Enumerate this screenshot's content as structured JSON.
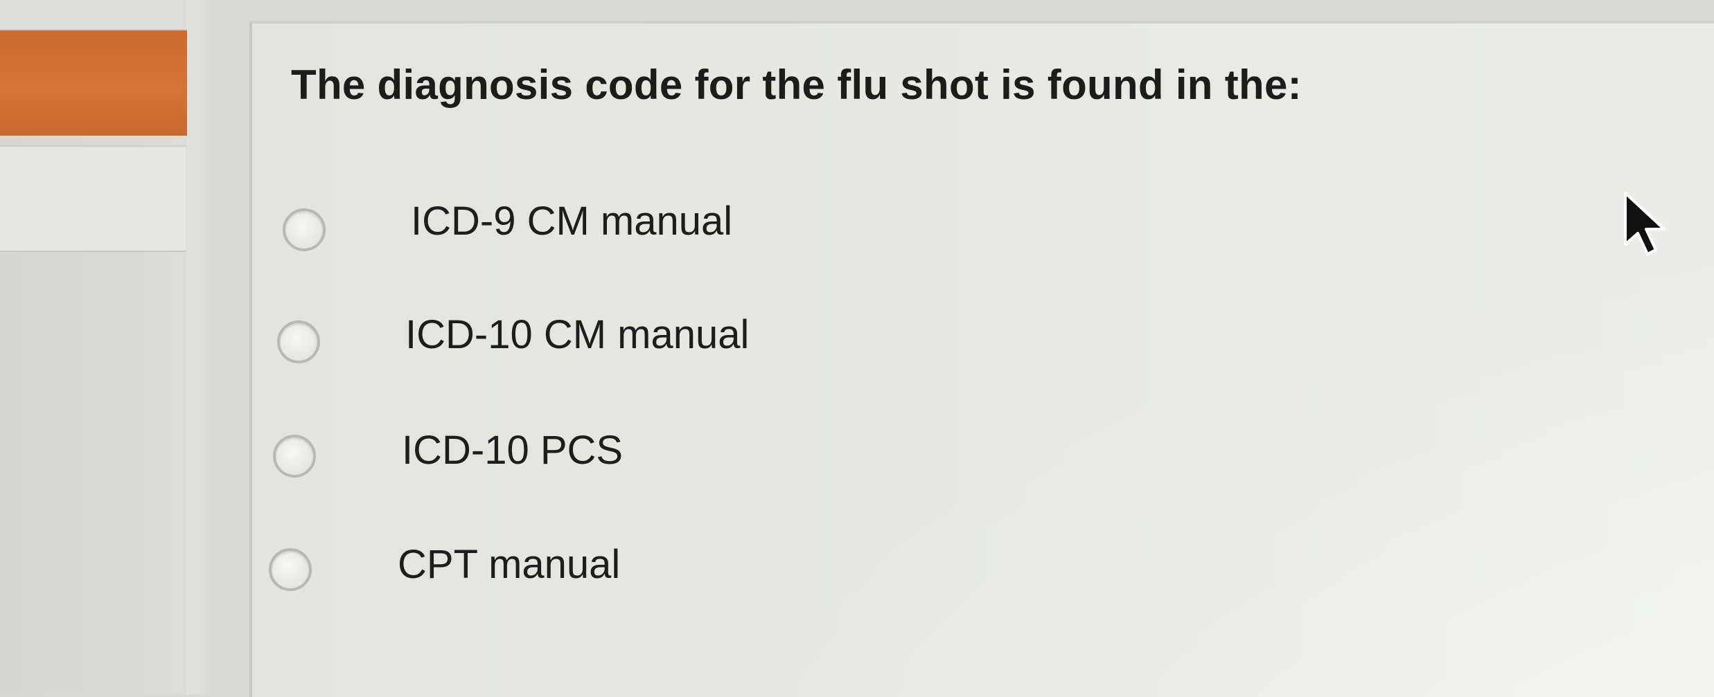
{
  "question": {
    "text": "The diagnosis code for the flu shot is found in the:"
  },
  "options": [
    {
      "label": "ICD-9 CM manual",
      "selected": false
    },
    {
      "label": "ICD-10 CM manual",
      "selected": false
    },
    {
      "label": "ICD-10 PCS",
      "selected": false
    },
    {
      "label": "CPT manual",
      "selected": false
    }
  ],
  "colors": {
    "accent_tab": "#d37535",
    "panel_background": "#e7e8e4",
    "text": "#1c1c1c"
  }
}
